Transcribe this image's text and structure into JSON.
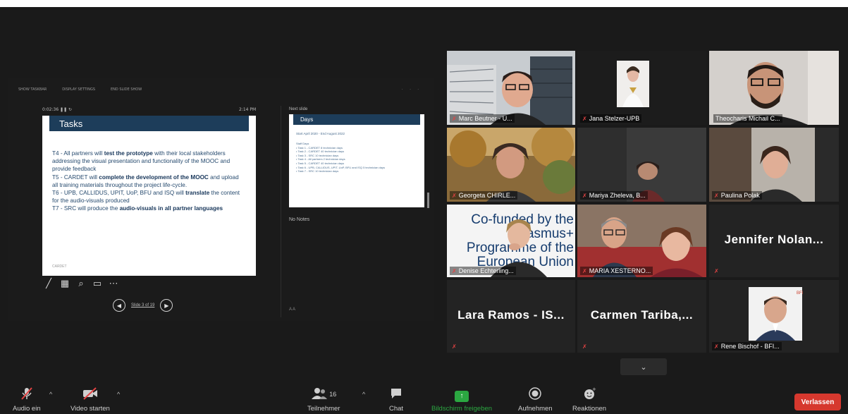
{
  "ppt": {
    "toolbar": [
      "SHOW TASKBAR",
      "DISPLAY SETTINGS",
      "END SLIDE SHOW"
    ],
    "toolbar_dots": "· · ·",
    "timer": "0:02:36  ❚❚  ↻",
    "clock": "2:14 PM",
    "slide_title": "Tasks",
    "slide_footer": "CARDET",
    "slide_lines": [
      {
        "pre": "T4 - All partners will ",
        "bold": "test the prototype",
        "post": " with their local stakeholders addressing the visual presentation and functionality of the MOOC and provide feedback"
      },
      {
        "pre": "T5 - CARDET will ",
        "bold": "complete the development of the MOOC",
        "post": " and upload all training materials throughout the project life-cycle."
      },
      {
        "pre": "T6 - UPB, CALLIDUS, UPIT, UoP, BFU and ISQ will ",
        "bold": "translate",
        "post": " the content for the audio-visuals produced"
      },
      {
        "pre": "T7 - SRC will produce the ",
        "bold": "audio-visuals in all partner languages",
        "post": ""
      }
    ],
    "slide_counter": "Slide 3 of 19",
    "prev_glyph": "◀",
    "next_glyph": "▶",
    "pen_tools": [
      "╱",
      "▦",
      "⌕",
      "▭",
      "⋯"
    ],
    "next_label": "Next slide",
    "next_title": "Days",
    "next_sub": "Start April 2020 - End August 2022",
    "next_list": [
      "Staff Days",
      "• Task 1 - CARDET 8 technician days",
      "• Task 2 - CARDET 40 technician days",
      "• Task 3 - SRC 10 technician days",
      "• Task 4 - All partners 2 technician days",
      "• Task 5 - CARDET 40 technician days",
      "• Task 6 - UPB, CALLIDUS, UPIT, UoP, BFU and ISQ 5 technician days",
      "• Task 7 - SRC 10 technician days"
    ],
    "no_notes": "No Notes",
    "font_ctrl": "A  A"
  },
  "participants": [
    {
      "name": "Marc Beutner - U..."
    },
    {
      "name": "Jana Stelzer-UPB"
    },
    {
      "name": "Theocharis Michail C..."
    },
    {
      "name": "Georgeta CHIRLE..."
    },
    {
      "name": "Mariya Zheleva, B..."
    },
    {
      "name": "Paulina Polak"
    },
    {
      "name": "Denise Echterling..."
    },
    {
      "name": "MARIA XESTERNO..."
    },
    {
      "name": "Jennifer Nolan..."
    },
    {
      "name": "Lara Ramos - IS..."
    },
    {
      "name": "Carmen Tariba,..."
    },
    {
      "name": "Rene Bischof - BFI..."
    }
  ],
  "banner_text": "Co-funded by the Erasmus+ Programme of the European Union",
  "mic_off_glyph": "✗",
  "toolbar": {
    "audio": "Audio ein",
    "video": "Video starten",
    "participants": "Teilnehmer",
    "participant_count": "16",
    "chat": "Chat",
    "share": "Bildschirm freigeben",
    "record": "Aufnehmen",
    "reactions": "Reaktionen",
    "leave": "Verlassen",
    "caret": "^",
    "chevron": "⌄"
  },
  "colors": {
    "active_speaker": "#d8e64c",
    "leave": "#d6382e",
    "share_green": "#2ba741",
    "mic_off": "#e34343"
  }
}
